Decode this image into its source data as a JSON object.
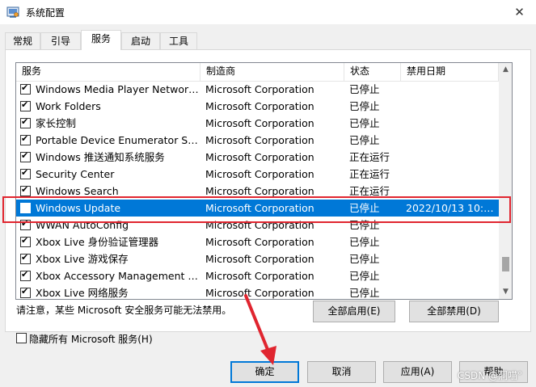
{
  "window": {
    "title": "系统配置",
    "close_glyph": "✕"
  },
  "tabs": [
    {
      "label": "常规"
    },
    {
      "label": "引导"
    },
    {
      "label": "服务"
    },
    {
      "label": "启动"
    },
    {
      "label": "工具"
    }
  ],
  "active_tab": "服务",
  "list": {
    "columns": [
      "服务",
      "制造商",
      "状态",
      "禁用日期"
    ],
    "rows": [
      {
        "name": "Windows Media Player Network ...",
        "manufacturer": "Microsoft Corporation",
        "status": "已停止",
        "date": "",
        "checked": true
      },
      {
        "name": "Work Folders",
        "manufacturer": "Microsoft Corporation",
        "status": "已停止",
        "date": "",
        "checked": true
      },
      {
        "name": "家长控制",
        "manufacturer": "Microsoft Corporation",
        "status": "已停止",
        "date": "",
        "checked": true
      },
      {
        "name": "Portable Device Enumerator Serv...",
        "manufacturer": "Microsoft Corporation",
        "status": "已停止",
        "date": "",
        "checked": true
      },
      {
        "name": "Windows 推送通知系统服务",
        "manufacturer": "Microsoft Corporation",
        "status": "正在运行",
        "date": "",
        "checked": true
      },
      {
        "name": "Security Center",
        "manufacturer": "Microsoft Corporation",
        "status": "正在运行",
        "date": "",
        "checked": true
      },
      {
        "name": "Windows Search",
        "manufacturer": "Microsoft Corporation",
        "status": "正在运行",
        "date": "",
        "checked": true
      },
      {
        "name": "Windows Update",
        "manufacturer": "Microsoft Corporation",
        "status": "已停止",
        "date": "2022/10/13 10:4...",
        "checked": false,
        "selected": true
      },
      {
        "name": "WWAN AutoConfig",
        "manufacturer": "Microsoft Corporation",
        "status": "已停止",
        "date": "",
        "checked": true
      },
      {
        "name": "Xbox Live 身份验证管理器",
        "manufacturer": "Microsoft Corporation",
        "status": "已停止",
        "date": "",
        "checked": true
      },
      {
        "name": "Xbox Live 游戏保存",
        "manufacturer": "Microsoft Corporation",
        "status": "已停止",
        "date": "",
        "checked": true
      },
      {
        "name": "Xbox Accessory Management Se...",
        "manufacturer": "Microsoft Corporation",
        "status": "已停止",
        "date": "",
        "checked": true
      },
      {
        "name": "Xbox Live 网络服务",
        "manufacturer": "Microsoft Corporation",
        "status": "已停止",
        "date": "",
        "checked": true
      }
    ]
  },
  "note": "请注意，某些 Microsoft 安全服务可能无法禁用。",
  "enable_all_label": "全部启用(E)",
  "disable_all_label": "全部禁用(D)",
  "hide_ms_label": "隐藏所有 Microsoft 服务(H)",
  "buttons": {
    "ok": "确定",
    "cancel": "取消",
    "apply": "应用(A)",
    "help": "帮助"
  },
  "watermark": "CSDN @洞喵°",
  "colors": {
    "selection": "#0078d7",
    "highlight": "#e0252f",
    "arrow": "#e0252f"
  }
}
